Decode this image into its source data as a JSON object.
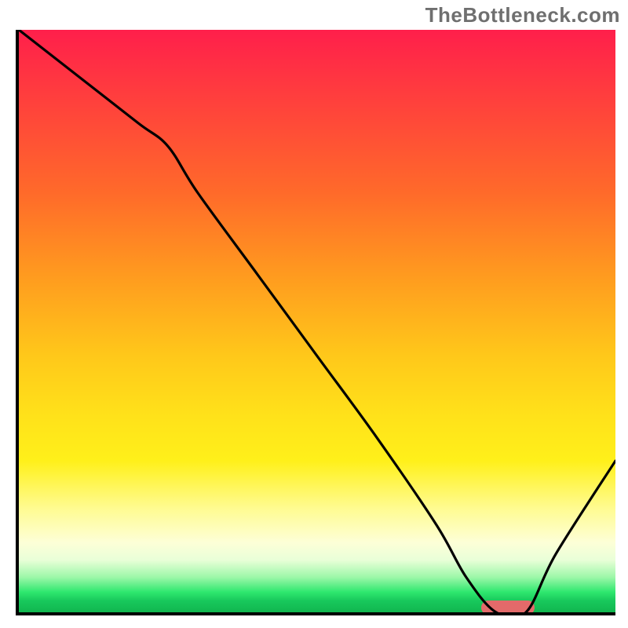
{
  "watermark": "TheBottleneck.com",
  "colors": {
    "axis": "#000000",
    "curve": "#000000",
    "capsule": "#e36a6a",
    "gradient_stops": [
      "#ff1f4b",
      "#ff6a2a",
      "#ffc81a",
      "#fff01a",
      "#fdffd7",
      "#2fe86f",
      "#11b64f"
    ]
  },
  "chart_data": {
    "type": "line",
    "title": "",
    "xlabel": "",
    "ylabel": "",
    "xlim": [
      0,
      100
    ],
    "ylim": [
      0,
      100
    ],
    "x": [
      0,
      10,
      20,
      25,
      30,
      40,
      50,
      60,
      70,
      75,
      80,
      85,
      90,
      100
    ],
    "values": [
      100,
      92,
      84,
      80,
      72,
      58,
      44,
      30,
      15,
      6,
      0,
      0,
      10,
      26
    ],
    "capsule": {
      "x_center": 82,
      "y": 0.8,
      "width_pct": 9
    },
    "note": "x,y are percentages of the plot area; curve shows a steep descent from top-left to a valley near x≈80-85 then rises toward the right edge."
  }
}
